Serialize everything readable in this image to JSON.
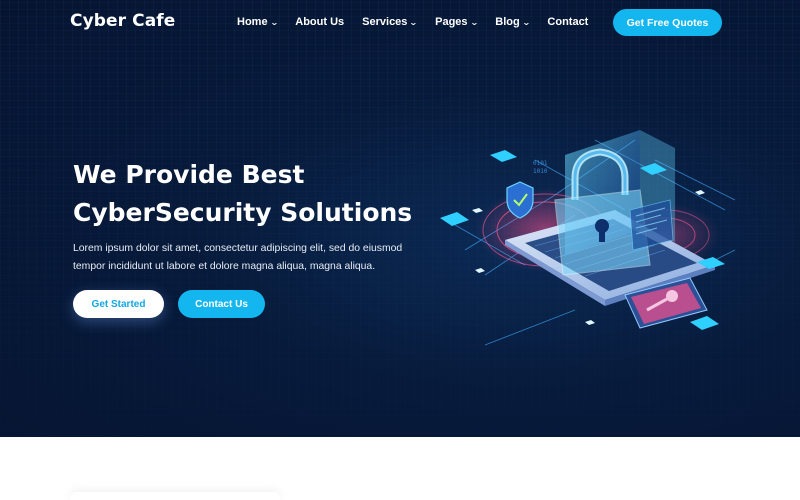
{
  "header": {
    "logo": "Cyber Cafe",
    "nav": [
      {
        "label": "Home",
        "has_dropdown": true
      },
      {
        "label": "About Us",
        "has_dropdown": false
      },
      {
        "label": "Services",
        "has_dropdown": true
      },
      {
        "label": "Pages",
        "has_dropdown": true
      },
      {
        "label": "Blog",
        "has_dropdown": true
      },
      {
        "label": "Contact",
        "has_dropdown": false
      }
    ],
    "cta_label": "Get Free Quotes"
  },
  "hero": {
    "title_line1": "We Provide Best",
    "title_line2": "CyberSecurity Solutions",
    "description": "Lorem ipsum dolor sit amet, consectetur adipiscing elit, sed do eiusmod tempor incididunt ut labore et dolore magna aliqua, magna aliqua.",
    "primary_button": "Get Started",
    "secondary_button": "Contact Us",
    "illustration_icons": [
      "padlock-icon",
      "shield-icon",
      "laptop-icon",
      "key-icon"
    ]
  },
  "colors": {
    "hero_bg": "#071a3a",
    "accent": "#13b6ee",
    "text_light": "#ffffff"
  }
}
